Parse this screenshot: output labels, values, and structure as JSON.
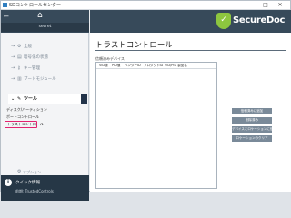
{
  "window": {
    "title": "SDコントロールセンター"
  },
  "sidebar": {
    "home_label": "⌂",
    "back_label": "←",
    "user_label": "secret",
    "items": [
      {
        "label": "全般",
        "icon": "gear-icon"
      },
      {
        "label": "暗号化の状態",
        "icon": "disk-icon"
      },
      {
        "label": "キー管理",
        "icon": "key-icon"
      },
      {
        "label": "ブートモジュール",
        "icon": "boot-icon"
      }
    ],
    "active_item": {
      "label": "ツール",
      "icon": "wrench-icon"
    },
    "sub_items": [
      "ディスク/パーティション",
      "ボートコントロール"
    ],
    "selected_sub_item": "トラストコントロール",
    "options_label": "オプション",
    "quick": {
      "title": "クイック情報",
      "text": "前期: TrustedControls"
    }
  },
  "main": {
    "logo_text": "SecureDoc",
    "page_title": "トラストコントロール",
    "section_label": "信頼済みデバイス",
    "columns": [
      "VID値",
      "PID値",
      "ベンダーID",
      "プロダクトID",
      "VID/PID 製品名"
    ],
    "buttons": [
      "信頼済みに追加",
      "削除済み",
      "デバイスとロケーションに信頼を追加",
      "ロケーションのクリア"
    ]
  }
}
